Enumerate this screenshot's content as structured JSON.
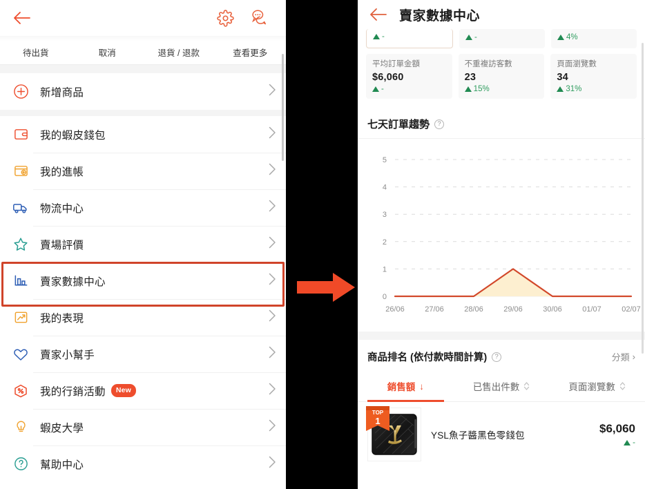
{
  "left_panel": {
    "header": {
      "back_icon": "back-arrow-icon",
      "settings_icon": "gear-icon",
      "chat_icon": "chat-bubbles-icon"
    },
    "order_tabs": [
      {
        "label": "待出貨"
      },
      {
        "label": "取消"
      },
      {
        "label": "退貨 / 退款"
      },
      {
        "label": "查看更多"
      }
    ],
    "menu_groups": [
      {
        "items": [
          {
            "label": "新增商品",
            "icon": "plus-circle-icon",
            "color": "#ee4d2d",
            "badge": "",
            "highlighted": false
          }
        ]
      },
      {
        "items": [
          {
            "label": "我的蝦皮錢包",
            "icon": "wallet-icon",
            "color": "#ee4d2d",
            "badge": "",
            "highlighted": false
          },
          {
            "label": "我的進帳",
            "icon": "income-icon",
            "color": "#f0a22e",
            "badge": "",
            "highlighted": false
          },
          {
            "label": "物流中心",
            "icon": "truck-icon",
            "color": "#2f5fb5",
            "badge": "",
            "highlighted": false
          },
          {
            "label": "賣場評價",
            "icon": "star-icon",
            "color": "#2a9e92",
            "badge": "",
            "highlighted": false
          },
          {
            "label": "賣家數據中心",
            "icon": "bar-chart-icon",
            "color": "#2f5fb5",
            "badge": "",
            "highlighted": true
          },
          {
            "label": "我的表現",
            "icon": "trend-up-icon",
            "color": "#f0a22e",
            "badge": "",
            "highlighted": false
          },
          {
            "label": "賣家小幫手",
            "icon": "heart-icon",
            "color": "#2f5fb5",
            "badge": "",
            "highlighted": false
          },
          {
            "label": "我的行銷活動",
            "icon": "discount-tag-icon",
            "color": "#ee4d2d",
            "badge": "New",
            "highlighted": false
          },
          {
            "label": "蝦皮大學",
            "icon": "lightbulb-icon",
            "color": "#f0a22e",
            "badge": "",
            "highlighted": false
          },
          {
            "label": "幫助中心",
            "icon": "question-circle-icon",
            "color": "#2a9e92",
            "badge": "",
            "highlighted": false
          }
        ]
      }
    ],
    "chevron_glyph": "›"
  },
  "middle": {
    "arrow_icon": "right-arrow-pointer",
    "arrow_color": "#f04a28"
  },
  "right_panel": {
    "header": {
      "back_icon": "back-arrow-icon",
      "title": "賣家數據中心"
    },
    "kpi_top_partial": [
      {
        "delta": "-",
        "selected": true
      },
      {
        "delta": "-",
        "selected": false
      },
      {
        "delta": "4%",
        "selected": false
      }
    ],
    "kpi_cards": [
      {
        "title": "平均訂單金額",
        "value": "$6,060",
        "delta": "-"
      },
      {
        "title": "不重複訪客數",
        "value": "23",
        "delta": "15%"
      },
      {
        "title": "頁面瀏覽數",
        "value": "34",
        "delta": "31%"
      }
    ],
    "trend_section": {
      "title": "七天訂單趨勢",
      "help_icon": "question-circle-icon",
      "help_glyph": "?"
    },
    "rank_section": {
      "title": "商品排名 (依付款時間計算)",
      "help_glyph": "?",
      "category_label": "分類",
      "category_chevron": "›",
      "sort_tabs": [
        {
          "label": "銷售額",
          "active": true,
          "arrow": "↓"
        },
        {
          "label": "已售出件數",
          "active": false,
          "arrow": ""
        },
        {
          "label": "頁面瀏覽數",
          "active": false,
          "arrow": ""
        }
      ],
      "products": [
        {
          "rank_badge_top": "TOP",
          "rank_badge_num": "1",
          "name": "YSL魚子醬黑色零錢包",
          "price": "$6,060",
          "delta": "-",
          "thumb_alt": "black-ysl-wallet"
        }
      ]
    }
  },
  "chart_data": {
    "type": "area",
    "title": "七天訂單趨勢",
    "categories": [
      "26/06",
      "27/06",
      "28/06",
      "29/06",
      "30/06",
      "01/07",
      "02/07"
    ],
    "values": [
      0,
      0,
      0,
      1,
      0,
      0,
      0
    ],
    "ytick_labels": [
      "5",
      "4",
      "3",
      "2",
      "1",
      "0"
    ],
    "ylim": [
      0,
      5
    ],
    "xlabel": "",
    "ylabel": "",
    "grid": true,
    "grid_style": "dashed",
    "legend": "none",
    "line_color": "#d2482a",
    "fill_color": "#fdefd0"
  },
  "colors": {
    "accent": "#ee4d2d",
    "positive": "#2e9c5e",
    "highlight_border": "#d0442a",
    "panel_bg": "#ffffff",
    "page_bg": "#000000"
  }
}
